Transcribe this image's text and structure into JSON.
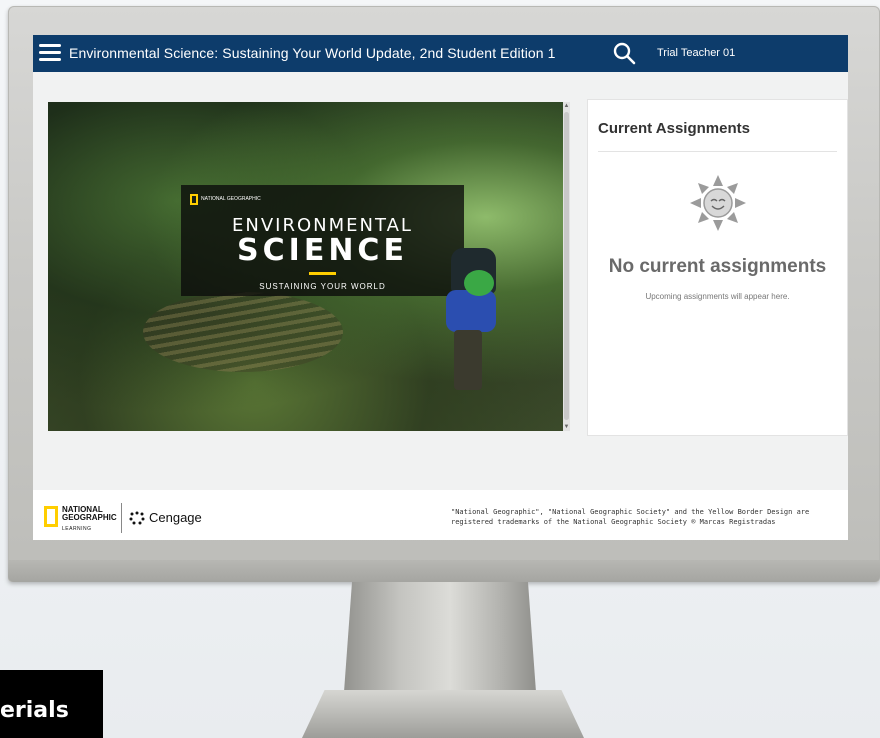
{
  "header": {
    "title": "Environmental Science: Sustaining Your World Update, 2nd Student Edition 1",
    "user": "Trial Teacher 01",
    "menu_icon": "hamburger-menu-icon",
    "search_icon": "search-icon"
  },
  "hero": {
    "publisher_mini": "NATIONAL GEOGRAPHIC",
    "line1": "ENVIRONMENTAL",
    "line2": "SCIENCE",
    "subtitle": "SUSTAINING YOUR WORLD"
  },
  "assignments": {
    "title": "Current Assignments",
    "empty_title": "No current assignments",
    "empty_subtitle": "Upcoming assignments will appear here.",
    "empty_icon": "sun-icon"
  },
  "footer": {
    "ng_line1": "NATIONAL",
    "ng_line2": "GEOGRAPHIC",
    "ng_line3": "LEARNING",
    "cengage": "Cengage",
    "legal": "\"National Geographic\", \"National Geographic Society\" and the Yellow Border Design are registered trademarks of the National Geographic Society ® Marcas Registradas"
  },
  "corner_badge": "erials",
  "colors": {
    "header_bg": "#0d3c6b",
    "ng_yellow": "#ffce00"
  }
}
